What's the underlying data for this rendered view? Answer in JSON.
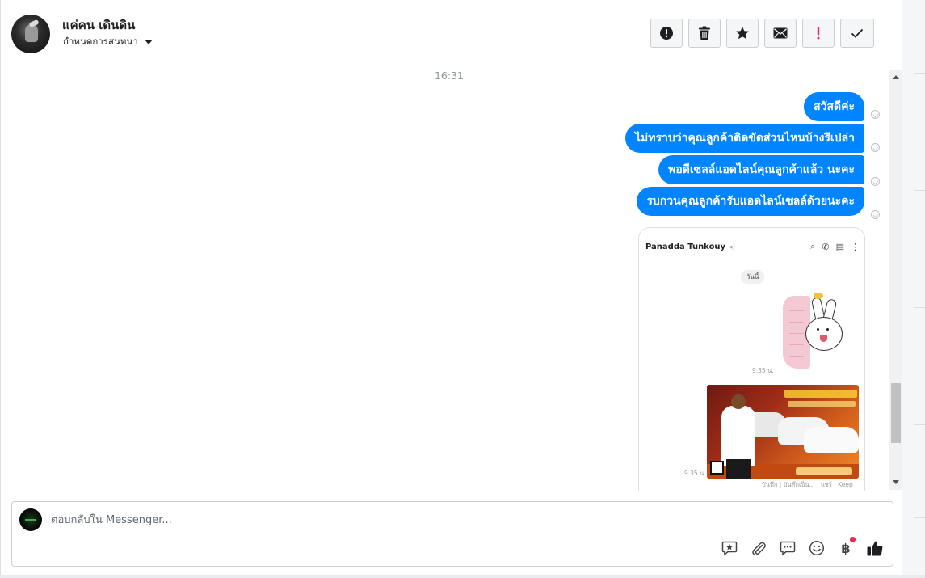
{
  "header": {
    "contact_name": "แค่คน เดินดิน",
    "conversation_settings_label": "กำหนดการสนทนา",
    "actions": [
      {
        "id": "report",
        "icon": "exclamation-circle-icon"
      },
      {
        "id": "delete",
        "icon": "trash-icon"
      },
      {
        "id": "star",
        "icon": "star-icon"
      },
      {
        "id": "mark-unread",
        "icon": "envelope-icon"
      },
      {
        "id": "priority",
        "icon": "exclamation-icon"
      },
      {
        "id": "done",
        "icon": "checkmark-icon"
      }
    ]
  },
  "conversation": {
    "timestamp": "16:31",
    "messages": [
      {
        "text": "สวัสดีค่ะ"
      },
      {
        "text": "ไม่ทราบว่าคุณลูกค้าติดขัดส่วนไหนบ้างรึเปล่า"
      },
      {
        "text": "พอดีเซลล์แอดไลน์คุณลูกค้าแล้ว นะคะ"
      },
      {
        "text": "รบกวนคุณลูกค้ารับแอดไลน์เซลล์ด้วยนะคะ"
      }
    ],
    "attachment": {
      "chat_name": "Panadda Tunkouy",
      "day_label": "วันนี้",
      "sticker_time": "9.35 น.",
      "image_time": "9.35 น.",
      "footer_links": "บันทึก | บันทึกเป็น... | แชร์ | Keep"
    }
  },
  "composer": {
    "placeholder": "ตอบกลับใน Messenger...",
    "tools": [
      {
        "id": "saved-replies",
        "icon": "saved-reply-icon"
      },
      {
        "id": "attach",
        "icon": "paperclip-icon"
      },
      {
        "id": "quick-reply",
        "icon": "chat-bubble-icon"
      },
      {
        "id": "emoji",
        "icon": "smiley-icon"
      },
      {
        "id": "payment",
        "icon": "baht-icon",
        "label": "฿"
      },
      {
        "id": "like",
        "icon": "thumbs-up-icon"
      }
    ]
  },
  "colors": {
    "accent": "#0084ff",
    "priority_red": "#f02849"
  }
}
